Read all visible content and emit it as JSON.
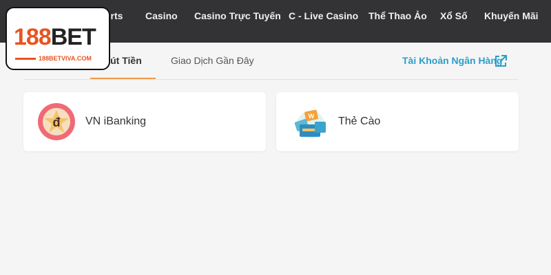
{
  "nav": {
    "items": [
      "orts",
      "Casino",
      "Casino Trực Tuyến",
      "C - Live Casino",
      "Thể Thao Ảo",
      "Xổ Số",
      "Khuyến Mãi"
    ]
  },
  "logo": {
    "number": "188",
    "word": "BET",
    "url": "188BETVIVA.COM"
  },
  "tabs": [
    {
      "label": "Rút Tiền",
      "active": true
    },
    {
      "label": "Giao Dịch Gần Đây",
      "active": false
    }
  ],
  "bank_link": {
    "label": "Tài Khoản Ngân Hàng",
    "icon": "external-link-icon"
  },
  "methods": [
    {
      "label": "VN iBanking",
      "icon": "dong-coin-icon"
    },
    {
      "label": "Thẻ Cào",
      "icon": "scratch-card-icon"
    }
  ],
  "colors": {
    "topbar": "#333336",
    "accent": "#f2994a",
    "link": "#2a9ec9",
    "brand_orange": "#e8541f",
    "background": "#f5f5f5"
  }
}
